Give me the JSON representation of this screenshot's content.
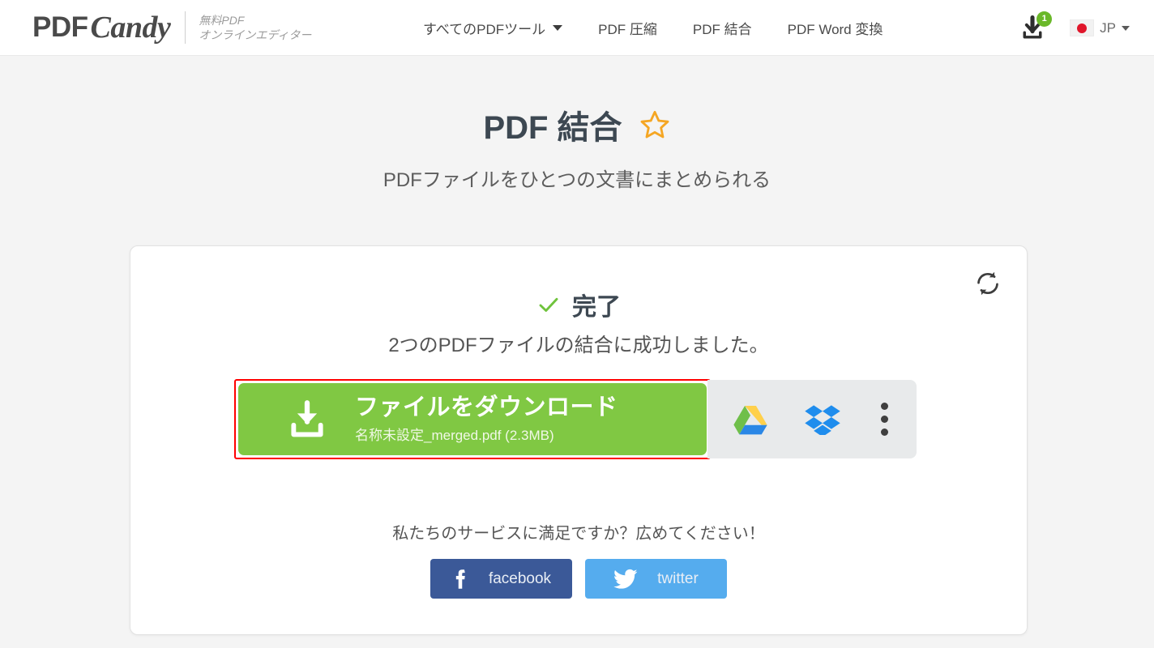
{
  "header": {
    "logo": {
      "primary": "PDF",
      "script": "Candy",
      "sub_line1": "無料PDF",
      "sub_line2": "オンラインエディター"
    },
    "nav": [
      {
        "label": "すべてのPDFツール",
        "has_caret": true
      },
      {
        "label": "PDF 圧縮",
        "has_caret": false
      },
      {
        "label": "PDF 結合",
        "has_caret": false
      },
      {
        "label": "PDF Word 変換",
        "has_caret": false
      }
    ],
    "downloads_badge": "1",
    "language": {
      "code": "JP",
      "flag": "jp-flag-icon"
    }
  },
  "page": {
    "title": "PDF 結合",
    "favorite_icon": "star-icon",
    "subtitle": "PDFファイルをひとつの文書にまとめられる"
  },
  "card": {
    "restart_icon": "refresh-icon",
    "status_icon": "check-icon",
    "status_title": "完了",
    "status_message": "2つのPDFファイルの結合に成功しました。",
    "download": {
      "icon": "download-icon",
      "label": "ファイルをダウンロード",
      "filename": "名称未設定_merged.pdf (2.3MB)",
      "highlighted": true
    },
    "cloud_actions": [
      {
        "name": "google-drive",
        "icon": "google-drive-icon"
      },
      {
        "name": "dropbox",
        "icon": "dropbox-icon"
      },
      {
        "name": "more-options",
        "icon": "kebab-menu-icon"
      }
    ],
    "share": {
      "prompt": "私たちのサービスに満足ですか？広めてください！",
      "buttons": [
        {
          "name": "facebook",
          "label": "facebook",
          "icon": "facebook-icon"
        },
        {
          "name": "twitter",
          "label": "twitter",
          "icon": "twitter-icon"
        }
      ]
    }
  },
  "colors": {
    "accent_green": "#80c843",
    "highlight_red": "#ff0000",
    "badge_green": "#6ab829",
    "facebook_blue": "#3b5998",
    "twitter_blue": "#55acee",
    "star_orange": "#f5a623",
    "page_bg": "#f4f4f4"
  }
}
